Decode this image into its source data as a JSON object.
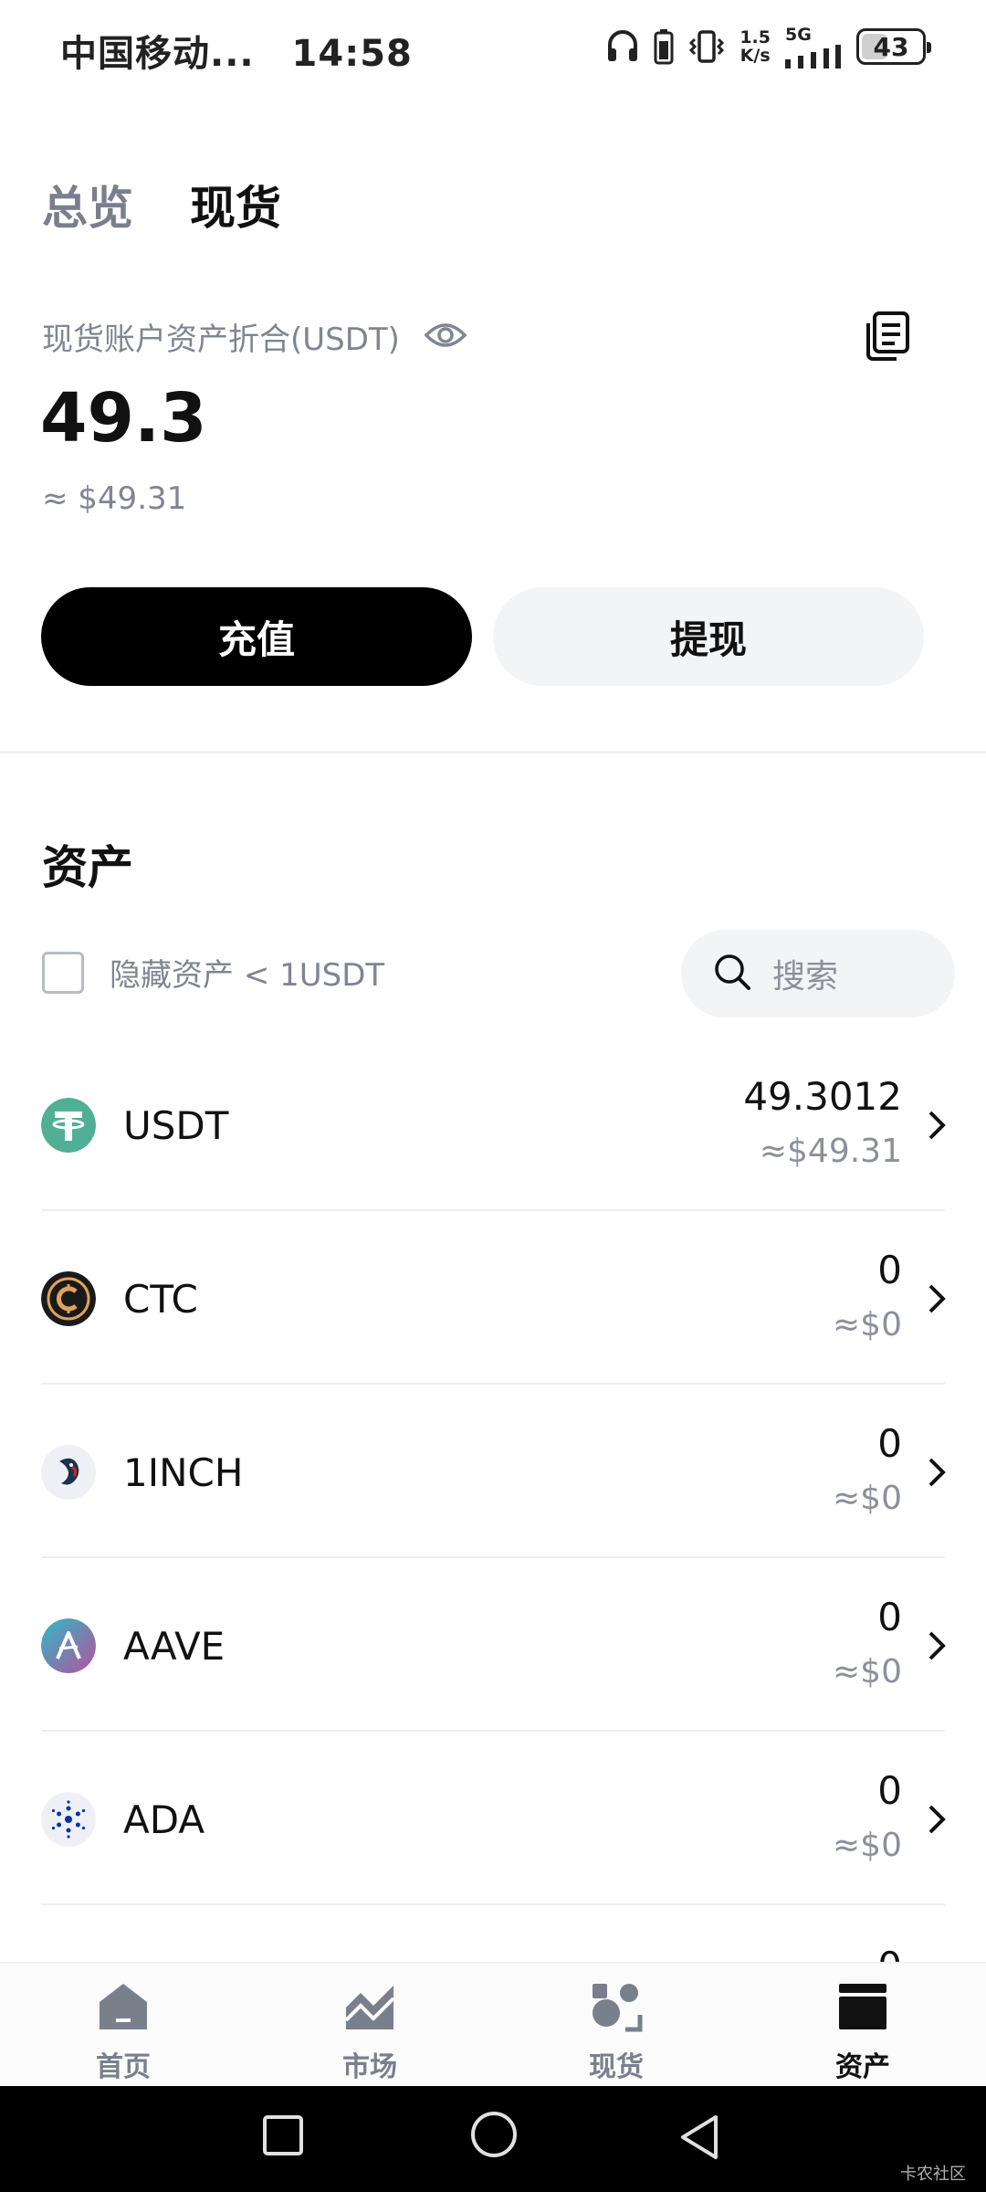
{
  "status_bar": {
    "carrier": "中国移动...",
    "time": "14:58",
    "net_speed_value": "1.5",
    "net_speed_unit": "K/s",
    "net_type": "5G",
    "battery": "43",
    "battery_fraction": 0.43
  },
  "top_tabs": [
    {
      "label": "总览",
      "active": false
    },
    {
      "label": "现货",
      "active": true
    }
  ],
  "account": {
    "label": "现货账户资产折合(USDT)",
    "value": "49.3",
    "usd_value": "≈ $49.31",
    "deposit_label": "充值",
    "withdraw_label": "提现"
  },
  "assets": {
    "title": "资产",
    "hide_small_label": "隐藏资产 < 1USDT",
    "search_placeholder": "搜索",
    "items": [
      {
        "symbol": "USDT",
        "amount": "49.3012",
        "usd": "≈$49.31",
        "icon": "usdt-icon"
      },
      {
        "symbol": "CTC",
        "amount": "0",
        "usd": "≈$0",
        "icon": "ctc-icon"
      },
      {
        "symbol": "1INCH",
        "amount": "0",
        "usd": "≈$0",
        "icon": "1inch-icon"
      },
      {
        "symbol": "AAVE",
        "amount": "0",
        "usd": "≈$0",
        "icon": "aave-icon"
      },
      {
        "symbol": "ADA",
        "amount": "0",
        "usd": "≈$0",
        "icon": "ada-icon"
      }
    ],
    "peek_amount": "0"
  },
  "bottom_nav": [
    {
      "label": "首页",
      "icon": "home-icon",
      "active": false
    },
    {
      "label": "市场",
      "icon": "market-chart-icon",
      "active": false
    },
    {
      "label": "现货",
      "icon": "spot-icon",
      "active": false
    },
    {
      "label": "资产",
      "icon": "wallet-icon",
      "active": true
    }
  ],
  "watermark": "卡农社区",
  "colors": {
    "primary_button": "#000000",
    "secondary_button": "#f3f4f6",
    "muted_text": "#808591",
    "usdt_green": "#50af95"
  }
}
